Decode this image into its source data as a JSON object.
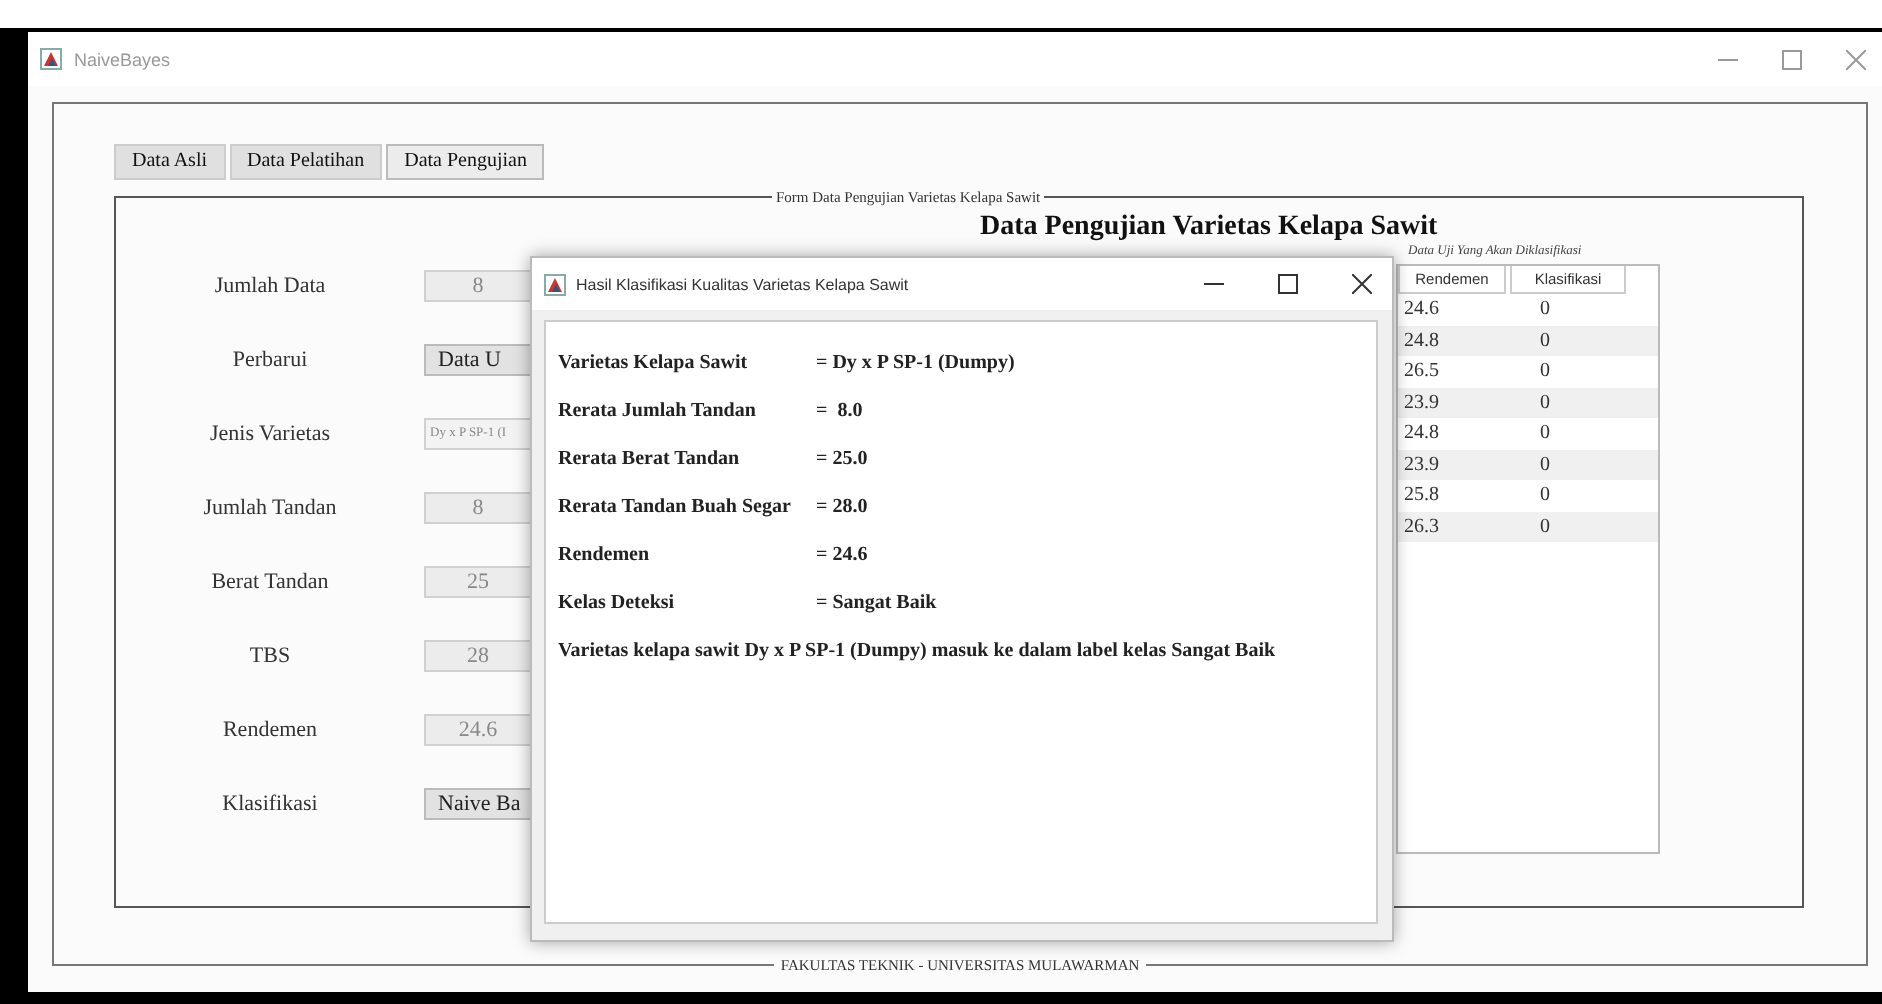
{
  "window": {
    "title": "NaiveBayes"
  },
  "tabs": [
    {
      "label": "Data Asli",
      "selected": false
    },
    {
      "label": "Data Pelatihan",
      "selected": false
    },
    {
      "label": "Data Pengujian",
      "selected": true
    }
  ],
  "form": {
    "legend": "Form Data Pengujian Varietas Kelapa Sawit",
    "heading": "Data Pengujian Varietas Kelapa Sawit",
    "fields": [
      {
        "label": "Jumlah Data",
        "kind": "text",
        "value": "8"
      },
      {
        "label": "Perbarui",
        "kind": "button",
        "value": "Data U"
      },
      {
        "label": "Jenis Varietas",
        "kind": "combo",
        "value": "Dy x P SP-1 (I"
      },
      {
        "label": "Jumlah Tandan",
        "kind": "text",
        "value": "8"
      },
      {
        "label": "Berat Tandan",
        "kind": "text",
        "value": "25"
      },
      {
        "label": "TBS",
        "kind": "text",
        "value": "28"
      },
      {
        "label": "Rendemen",
        "kind": "text",
        "value": "24.6"
      },
      {
        "label": "Klasifikasi",
        "kind": "button",
        "value": "Naive Ba"
      }
    ]
  },
  "table": {
    "caption": "Data Uji Yang Akan Diklasifikasi",
    "columns": [
      "Rendemen",
      "Klasifikasi"
    ],
    "rows": [
      [
        "24.6",
        "0"
      ],
      [
        "24.8",
        "0"
      ],
      [
        "26.5",
        "0"
      ],
      [
        "23.9",
        "0"
      ],
      [
        "24.8",
        "0"
      ],
      [
        "23.9",
        "0"
      ],
      [
        "25.8",
        "0"
      ],
      [
        "26.3",
        "0"
      ]
    ]
  },
  "footer": "FAKULTAS TEKNIK - UNIVERSITAS MULAWARMAN",
  "dialog": {
    "title": "Hasil Klasifikasi Kualitas Varietas Kelapa Sawit",
    "lines": [
      {
        "label": "Varietas Kelapa Sawit",
        "value": "= Dy x P SP-1 (Dumpy)"
      },
      {
        "label": "Rerata Jumlah Tandan",
        "value": "=  8.0"
      },
      {
        "label": "Rerata Berat Tandan",
        "value": "= 25.0"
      },
      {
        "label": "Rerata Tandan Buah Segar",
        "value": "= 28.0"
      },
      {
        "label": "Rendemen",
        "value": "= 24.6"
      },
      {
        "label": "Kelas Deteksi",
        "value": "= Sangat Baik"
      }
    ],
    "conclusion": "Varietas kelapa sawit Dy x P SP-1 (Dumpy) masuk ke dalam label kelas Sangat Baik"
  }
}
